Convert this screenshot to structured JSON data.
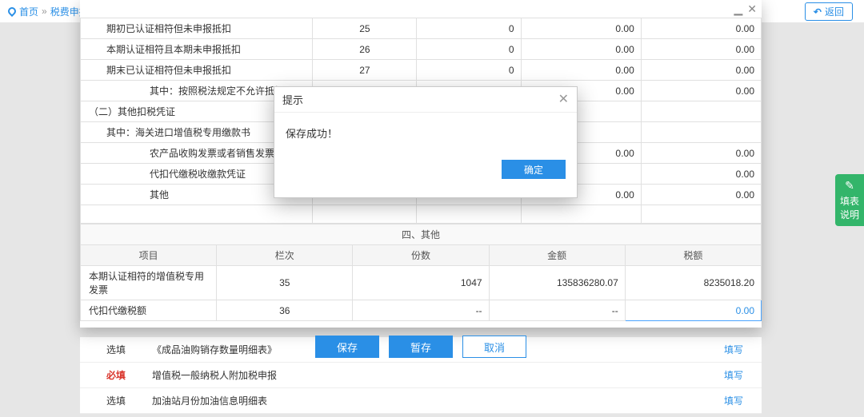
{
  "breadcrumb": {
    "home": "首页",
    "current": "税费申报及缴纳"
  },
  "back_label": "返回",
  "window": {
    "minimize": "▁",
    "close": "✕"
  },
  "rows": [
    {
      "name": "期初已认证相符但未申报抵扣",
      "indent": 1,
      "a": "25",
      "b": "0",
      "c": "0.00",
      "d": "0.00"
    },
    {
      "name": "本期认证相符且本期未申报抵扣",
      "indent": 1,
      "a": "26",
      "b": "0",
      "c": "0.00",
      "d": "0.00"
    },
    {
      "name": "期末已认证相符但未申报抵扣",
      "indent": 1,
      "a": "27",
      "b": "0",
      "c": "0.00",
      "d": "0.00"
    },
    {
      "name": "其中：按照税法规定不允许抵扣",
      "indent": 2,
      "a": "",
      "b": "",
      "c": "0.00",
      "d": "0.00"
    },
    {
      "name": "（二）其他扣税凭证",
      "indent": 0,
      "a": "",
      "b": "",
      "c": "",
      "d": ""
    },
    {
      "name": "其中：海关进口增值税专用缴款书",
      "indent": 1,
      "a": "",
      "b": "",
      "c": "",
      "d": ""
    },
    {
      "name": "农产品收购发票或者销售发票",
      "indent": 2,
      "a": "",
      "b": "",
      "c": "0.00",
      "d": "0.00"
    },
    {
      "name": "代扣代缴税收缴款凭证",
      "indent": 2,
      "a": "",
      "b": "",
      "c": "",
      "d": "0.00"
    },
    {
      "name": "其他",
      "indent": 2,
      "a": "",
      "b": "",
      "c": "0.00",
      "d": "0.00"
    }
  ],
  "hidden_row": {
    "a": "",
    "b": "",
    "c": "",
    "d": ""
  },
  "section_title": "四、其他",
  "headers": {
    "name": "项目",
    "a": "栏次",
    "b": "份数",
    "c": "金额",
    "d": "税额"
  },
  "other_rows": [
    {
      "name": "本期认证相符的增值税专用发票",
      "a": "35",
      "b": "1047",
      "c": "135836280.07",
      "d": "8235018.20",
      "active": false
    },
    {
      "name": "代扣代缴税额",
      "a": "36",
      "b": "--",
      "c": "--",
      "d": "0.00",
      "active": true
    }
  ],
  "buttons": {
    "save": "保存",
    "tempsave": "暂存",
    "cancel": "取消"
  },
  "lower": [
    {
      "tag": "选填",
      "red": false,
      "title": "《成品油购销存数量明细表》",
      "action": "填写"
    },
    {
      "tag": "必填",
      "red": true,
      "title": "增值税一般纳税人附加税申报",
      "action": "填写"
    },
    {
      "tag": "选填",
      "red": false,
      "title": "加油站月份加油信息明细表",
      "action": "填写"
    }
  ],
  "sidetab": {
    "icon": "✎",
    "label": "填表说明"
  },
  "modal": {
    "title": "提示",
    "message": "保存成功！",
    "ok": "确定"
  }
}
